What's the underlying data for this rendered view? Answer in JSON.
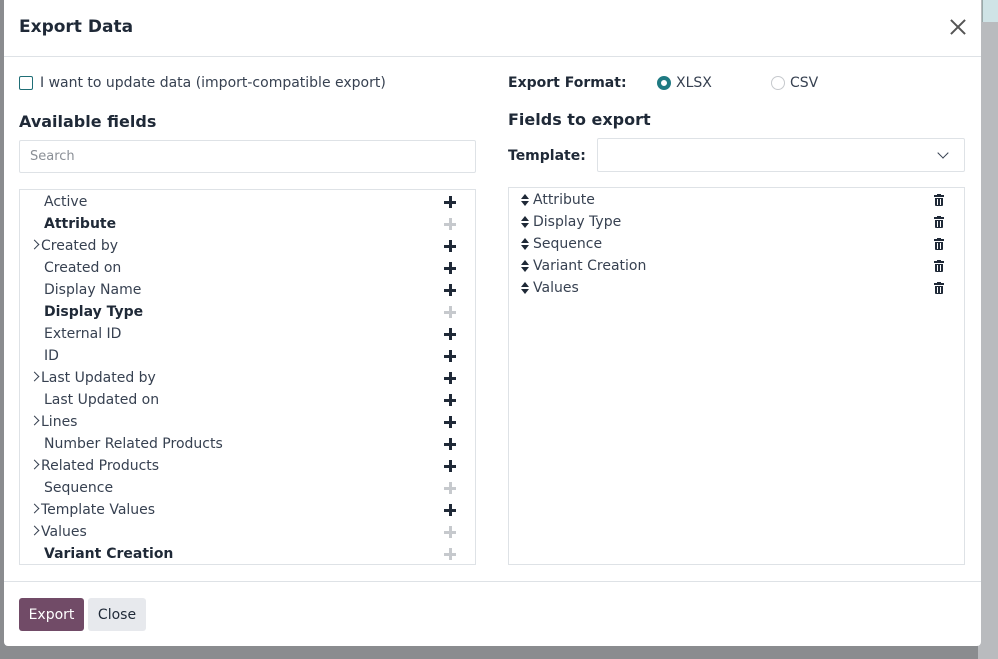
{
  "dialog": {
    "title": "Export Data"
  },
  "import_compat": {
    "label": "I want to update data (import-compatible export)",
    "checked": false
  },
  "available": {
    "title": "Available fields",
    "search_placeholder": "Search",
    "fields": [
      {
        "label": "Active",
        "expandable": false,
        "bold": false,
        "addable": true
      },
      {
        "label": "Attribute",
        "expandable": false,
        "bold": true,
        "addable": false
      },
      {
        "label": "Created by",
        "expandable": true,
        "bold": false,
        "addable": true
      },
      {
        "label": "Created on",
        "expandable": false,
        "bold": false,
        "addable": true
      },
      {
        "label": "Display Name",
        "expandable": false,
        "bold": false,
        "addable": true
      },
      {
        "label": "Display Type",
        "expandable": false,
        "bold": true,
        "addable": false
      },
      {
        "label": "External ID",
        "expandable": false,
        "bold": false,
        "addable": true
      },
      {
        "label": "ID",
        "expandable": false,
        "bold": false,
        "addable": true
      },
      {
        "label": "Last Updated by",
        "expandable": true,
        "bold": false,
        "addable": true
      },
      {
        "label": "Last Updated on",
        "expandable": false,
        "bold": false,
        "addable": true
      },
      {
        "label": "Lines",
        "expandable": true,
        "bold": false,
        "addable": true
      },
      {
        "label": "Number Related Products",
        "expandable": false,
        "bold": false,
        "addable": true
      },
      {
        "label": "Related Products",
        "expandable": true,
        "bold": false,
        "addable": true
      },
      {
        "label": "Sequence",
        "expandable": false,
        "bold": false,
        "addable": false
      },
      {
        "label": "Template Values",
        "expandable": true,
        "bold": false,
        "addable": true
      },
      {
        "label": "Values",
        "expandable": true,
        "bold": false,
        "addable": false
      },
      {
        "label": "Variant Creation",
        "expandable": false,
        "bold": true,
        "addable": false
      }
    ]
  },
  "format": {
    "label": "Export Format:",
    "options": [
      {
        "label": "XLSX",
        "selected": true
      },
      {
        "label": "CSV",
        "selected": false
      }
    ]
  },
  "to_export": {
    "title": "Fields to export",
    "template_label": "Template:",
    "template_value": "",
    "fields": [
      "Attribute",
      "Display Type",
      "Sequence",
      "Variant Creation",
      "Values"
    ]
  },
  "footer": {
    "export_label": "Export",
    "close_label": "Close"
  },
  "colors": {
    "primary": "#714b67",
    "accent": "#1f7a82"
  }
}
